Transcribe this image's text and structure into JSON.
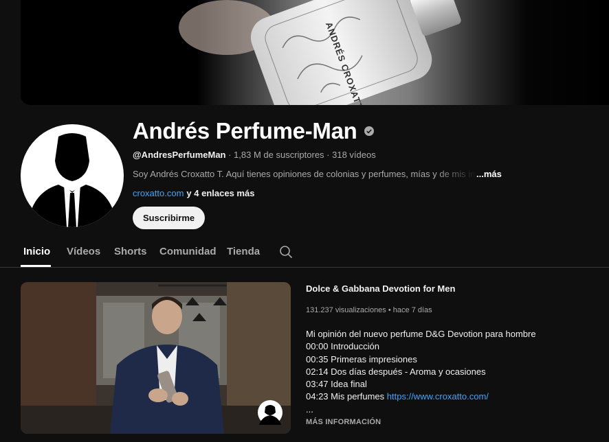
{
  "banner": {
    "bottle_text": "ANDRÉS CROXATTO MAN"
  },
  "channel": {
    "name": "Andrés Perfume-Man",
    "verified_icon": "verified-check-icon",
    "handle": "@AndresPerfumeMan",
    "subscribers": "1,83 M de suscriptores",
    "video_count": "318 vídeos",
    "separator": " · ",
    "description": "Soy Andrés Croxatto T. Aquí tienes opiniones de colonias y perfumes, mías y de mis invitados",
    "description_more": "...más",
    "link": "croxatto.com",
    "more_links": "y 4 enlaces más",
    "subscribe_label": "Suscribirme"
  },
  "tabs": {
    "items": [
      {
        "label": "Inicio",
        "active": true
      },
      {
        "label": "Vídeos",
        "active": false
      },
      {
        "label": "Shorts",
        "active": false
      },
      {
        "label": "Comunidad",
        "active": false
      },
      {
        "label": "Tienda",
        "active": false
      }
    ],
    "search_icon": "search-icon"
  },
  "featured_video": {
    "title": "Dolce & Gabbana Devotion for Men",
    "views": "131.237 visualizaciones",
    "age": "hace 7 días",
    "stats_separator": " • ",
    "description_lines": [
      "Mi opinión del nuevo perfume D&G Devotion para hombre",
      "00:00 Introducción",
      "00:35 Primeras impresiones",
      "02:14 Dos días después - Aroma y ocasiones",
      "03:47 Idea final"
    ],
    "last_line_prefix": "04:23 Mis perfumes ",
    "last_line_url": "https://www.croxatto.com/",
    "ellipsis": "...",
    "more_info_label": "MÁS INFORMACIÓN"
  },
  "colors": {
    "background": "#0f0f0f",
    "text": "#f1f1f1",
    "secondary_text": "#aaaaaa",
    "link": "#3ea6ff",
    "subscribe_bg": "#f1f1f1"
  }
}
